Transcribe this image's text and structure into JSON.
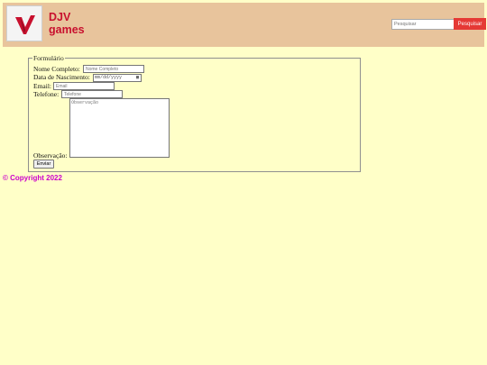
{
  "header": {
    "brand_line1": "DJV",
    "brand_line2": "games",
    "search_placeholder": "Pesquisar",
    "search_button": "Pesquisar",
    "logo_color": "#c8102e"
  },
  "form": {
    "legend": "Formulário",
    "name_label": "Nome Completo:",
    "name_placeholder": "Nome Completo",
    "birth_label": "Data de Nascimento:",
    "birth_placeholder": "mm/dd/yyyy",
    "email_label": "Email:",
    "email_placeholder": "Email",
    "phone_label": "Telefone:",
    "phone_placeholder": "Telefone",
    "obs_label": "Observação:",
    "obs_placeholder": "Observação",
    "submit": "Enviar"
  },
  "footer": {
    "copyright": "© Copyright 2022"
  },
  "icons": {
    "logo": "v-logo-icon",
    "calendar": "calendar-icon"
  }
}
